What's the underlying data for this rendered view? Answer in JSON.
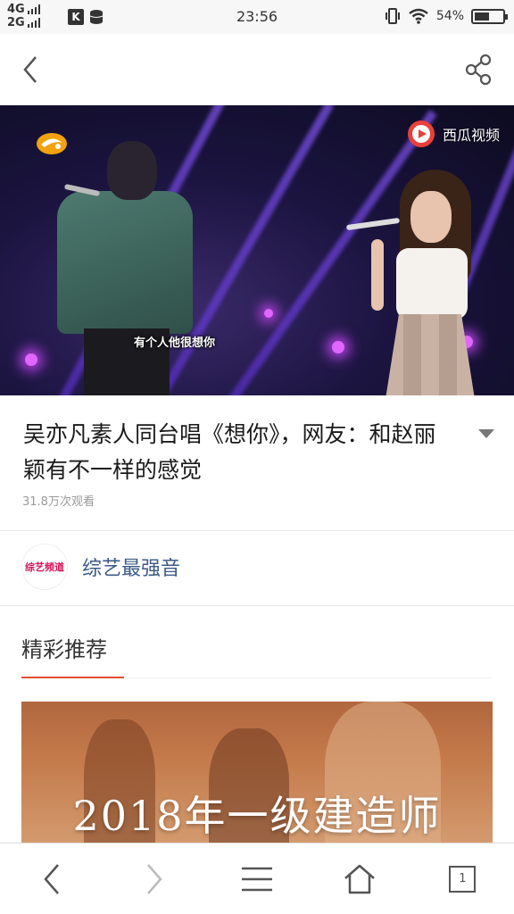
{
  "status_bar": {
    "network_top": "4G",
    "network_bottom": "2G",
    "app_k_label": "K",
    "time": "23:56",
    "battery_percent_label": "54%",
    "battery_level": 0.54
  },
  "video": {
    "watermark_text": "西瓜视频",
    "subtitle_text": "有个人他很想你"
  },
  "article": {
    "title": "吴亦凡素人同台唱《想你》，网友：和赵丽颖有不一样的感觉",
    "views": "31.8万次观看"
  },
  "channel": {
    "avatar_text": "综艺频道",
    "name": "综艺最强音"
  },
  "recommendations": {
    "section_title": "精彩推荐",
    "card_text": "2018年一级建造师"
  },
  "bottom_nav": {
    "tabs_count": "1"
  },
  "colors": {
    "accent_underline": "#e05030",
    "channel_name": "#3c5a86",
    "xigua_red": "#e8403a"
  }
}
